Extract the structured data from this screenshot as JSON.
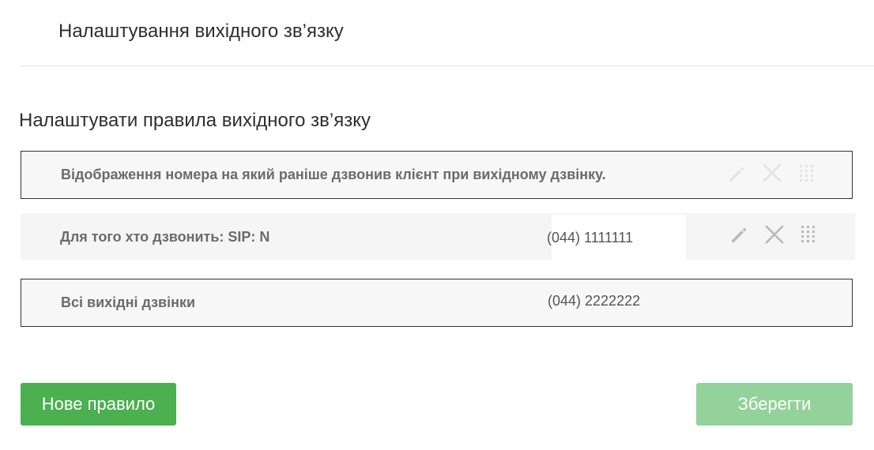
{
  "header": {
    "title": "Налаштування вихідного зв’язку"
  },
  "section": {
    "title": "Налаштувати правила вихідного зв’язку"
  },
  "rules": [
    {
      "name": "Відображення номера на який раніше дзвонив клієнт при вихідному дзвінку.",
      "phone": ""
    },
    {
      "name": "Для того хто дзвонить: SIP: N",
      "phone": "(044) 1111111"
    },
    {
      "name": "Всі вихідні дзвінки",
      "phone": "(044) 2222222"
    }
  ],
  "buttons": {
    "new_rule": "Нове правило",
    "save": "Зберегти"
  },
  "colors": {
    "primary_button": "#4caf50",
    "save_button_disabled": "#93d29a",
    "action_icon_muted": "#e3e3e3",
    "action_icon": "#b9b9b9"
  },
  "icons": {
    "edit": "pencil-icon",
    "delete": "close-icon",
    "reorder": "drag-handle-icon"
  }
}
